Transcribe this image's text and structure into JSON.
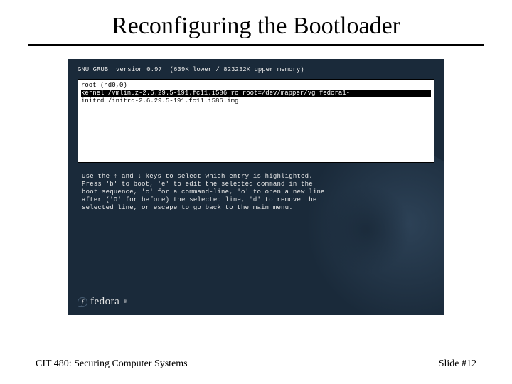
{
  "slide": {
    "title": "Reconfiguring the Bootloader",
    "footer_left": "CIT 480: Securing Computer Systems",
    "footer_right": "Slide #12"
  },
  "grub": {
    "header": "GNU GRUB  version 0.97  (639K lower / 823232K upper memory)",
    "menu": {
      "lines": [
        {
          "text": "root (hd0,0)",
          "selected": false
        },
        {
          "text": "kernel /vmlinuz-2.6.29.5-191.fc11.i586 ro root=/dev/mapper/vg_fedora1-",
          "selected": true,
          "arrow": "→"
        },
        {
          "text": "initrd /initrd-2.6.29.5-191.fc11.i586.img",
          "selected": false
        }
      ]
    },
    "help": "Use the ↑ and ↓ keys to select which entry is highlighted.\nPress 'b' to boot, 'e' to edit the selected command in the\nboot sequence, 'c' for a command-line, 'o' to open a new line\nafter ('O' for before) the selected line, 'd' to remove the\nselected line, or escape to go back to the main menu.",
    "brand": {
      "logo_letter": "f",
      "word": "fedora",
      "tm": "®"
    }
  }
}
